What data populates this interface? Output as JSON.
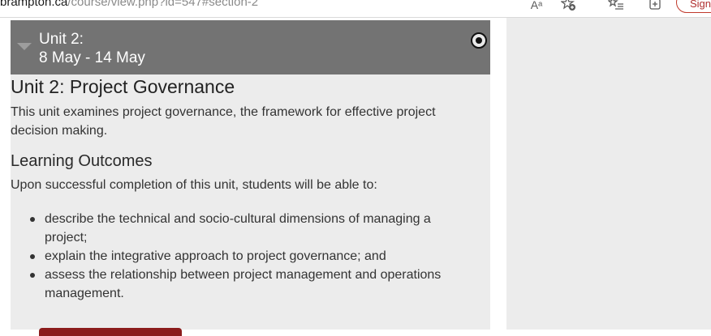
{
  "browser": {
    "url_domain": "brampton.ca",
    "url_path": "/course/view.php?id=547#section-2",
    "read_aloud_label": "Aᵃ",
    "signin_label": "Sign"
  },
  "section": {
    "title_line1": "Unit 2:",
    "title_line2": "8 May - 14 May"
  },
  "content": {
    "unit_heading": "Unit 2: Project Governance",
    "description": "This unit examines project governance, the framework for effective project decision making.",
    "outcomes_heading": "Learning Outcomes",
    "outcomes_intro": "Upon successful completion of this unit, students will be able to:",
    "outcomes": [
      "describe the technical and socio-cultural dimensions of managing a project;",
      "explain the integrative approach to project governance; and",
      "assess the relationship between project management and operations management."
    ]
  },
  "colors": {
    "section_header_bg": "#737373",
    "content_bg": "#ececec",
    "accent": "#8b1c1c"
  }
}
